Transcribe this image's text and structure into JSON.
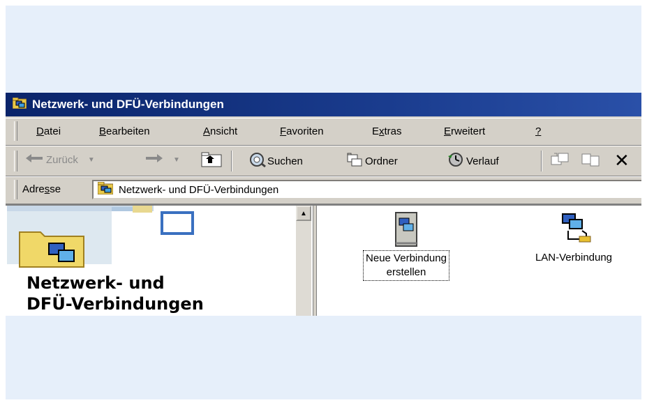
{
  "window": {
    "title": "Netzwerk- und DFÜ-Verbindungen"
  },
  "menu": [
    {
      "pre": "",
      "key": "D",
      "post": "atei"
    },
    {
      "pre": "",
      "key": "B",
      "post": "earbeiten"
    },
    {
      "pre": "",
      "key": "A",
      "post": "nsicht"
    },
    {
      "pre": "",
      "key": "F",
      "post": "avoriten"
    },
    {
      "pre": "E",
      "key": "x",
      "post": "tras"
    },
    {
      "pre": "",
      "key": "E",
      "post": "rweitert"
    },
    {
      "pre": "",
      "key": "?",
      "post": ""
    }
  ],
  "toolbar": {
    "back_label": "Zurück",
    "search_label": "Suchen",
    "folders_label": "Ordner",
    "history_label": "Verlauf"
  },
  "address": {
    "label_pre": "Adre",
    "label_key": "s",
    "label_post": "se",
    "value": "Netzwerk- und DFÜ-Verbindungen"
  },
  "leftpane": {
    "title_line1": "Netzwerk- und",
    "title_line2": "DFÜ-Verbindungen"
  },
  "items": [
    {
      "line1": "Neue Verbindung",
      "line2": "erstellen",
      "icon": "new-connection-icon"
    },
    {
      "line1": "LAN-Verbindung",
      "icon": "lan-connection-icon"
    }
  ],
  "colors": {
    "titlebar": "#0a246a",
    "chrome": "#d4d0c8",
    "backdrop": "#e6effa"
  }
}
